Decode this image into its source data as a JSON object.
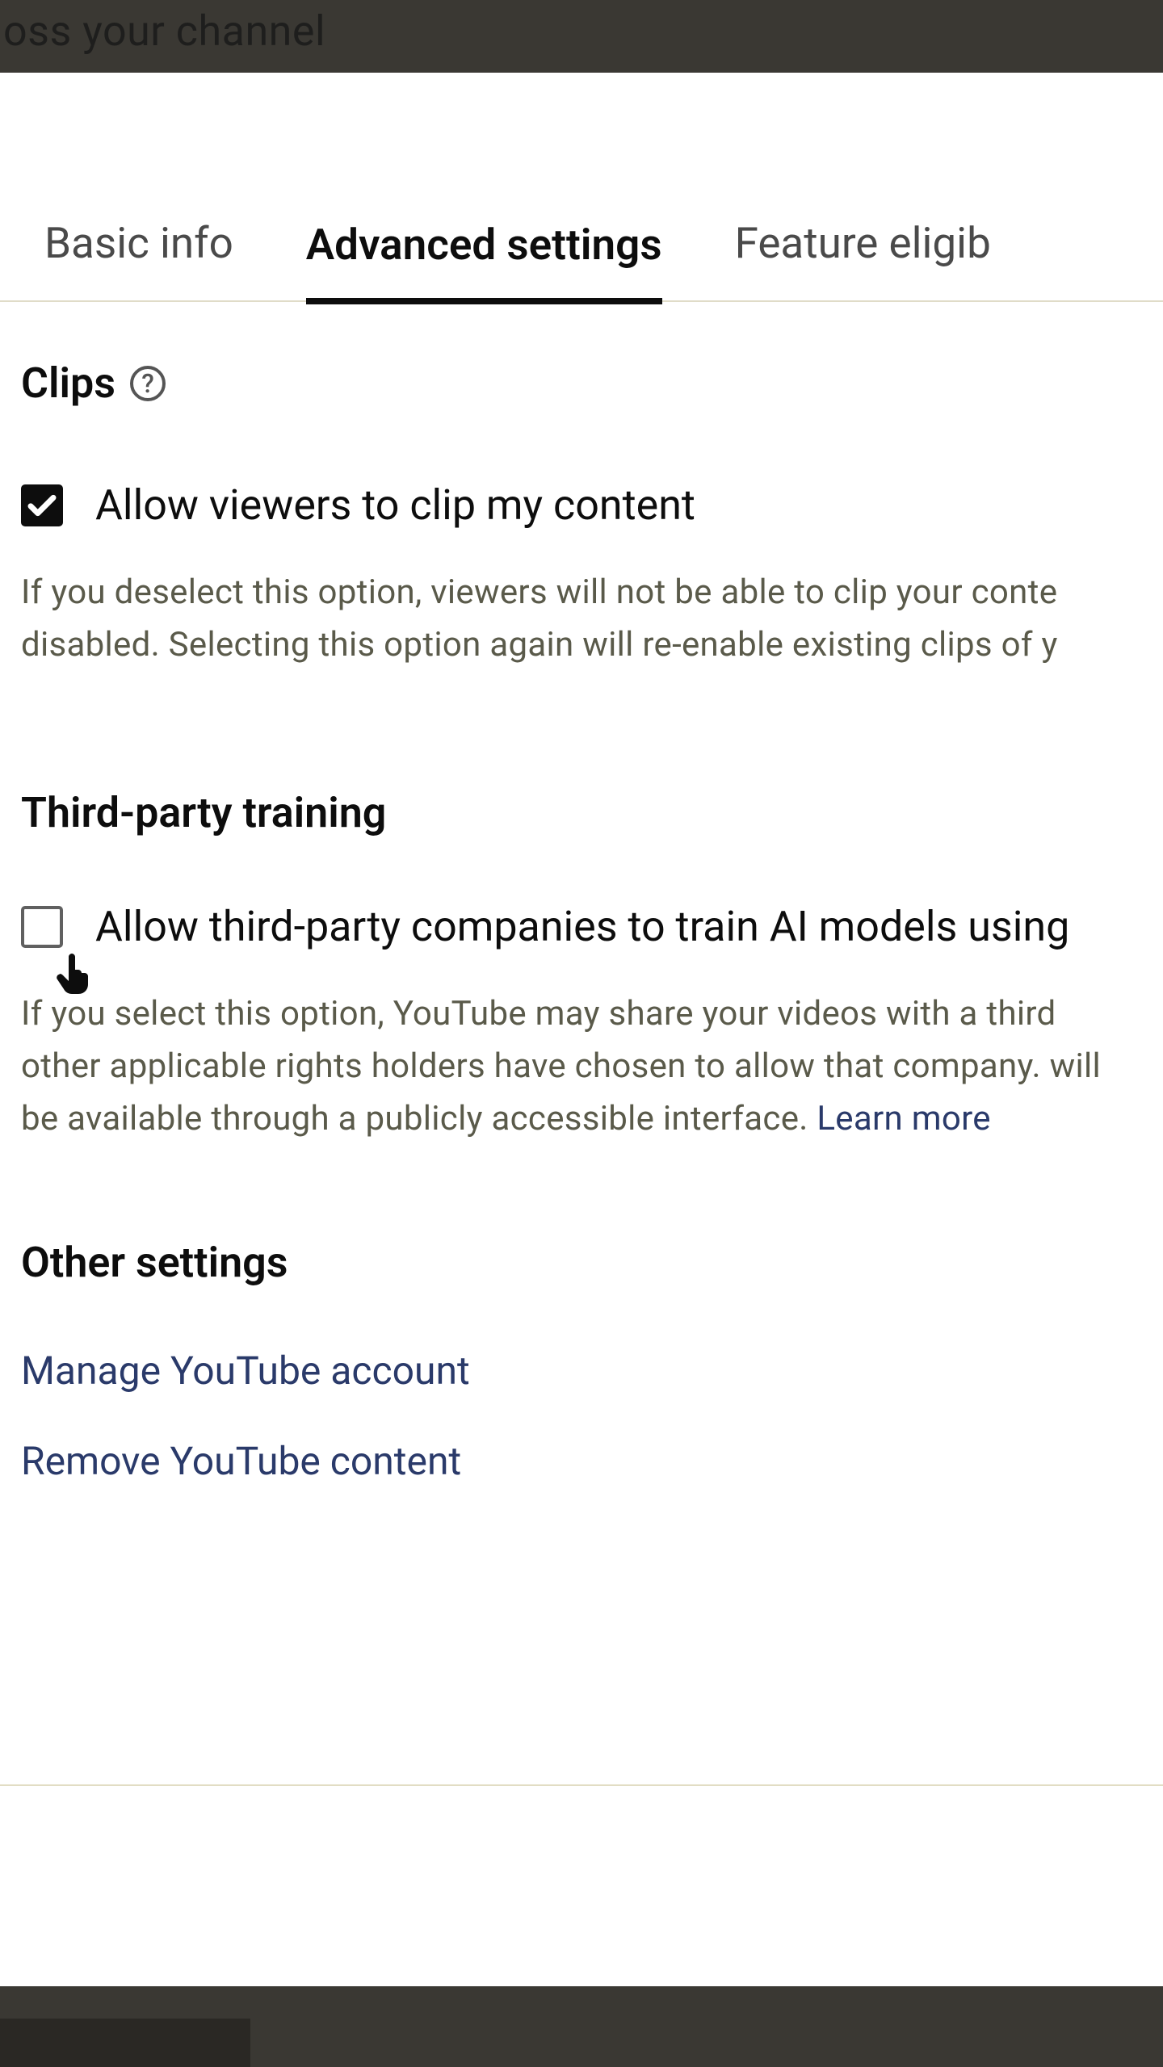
{
  "banner": {
    "text_fragment": "oss your channel"
  },
  "tabs": {
    "basic": "Basic info",
    "advanced": "Advanced settings",
    "feature": "Feature eligib"
  },
  "clips": {
    "title": "Clips",
    "checkbox_label": "Allow viewers to clip my content",
    "help": "If you deselect this option, viewers will not be able to clip your conte disabled. Selecting this option again will re-enable existing clips of y"
  },
  "third_party": {
    "title": "Third-party training",
    "checkbox_label": "Allow third-party companies to train AI models using",
    "help_part1": "If you select this option, YouTube may share your videos with a third other applicable rights holders have chosen to allow that company. will be available through a publicly accessible interface. ",
    "learn_more": "Learn more"
  },
  "other": {
    "title": "Other settings",
    "link1": "Manage YouTube account",
    "link2": "Remove YouTube content"
  }
}
